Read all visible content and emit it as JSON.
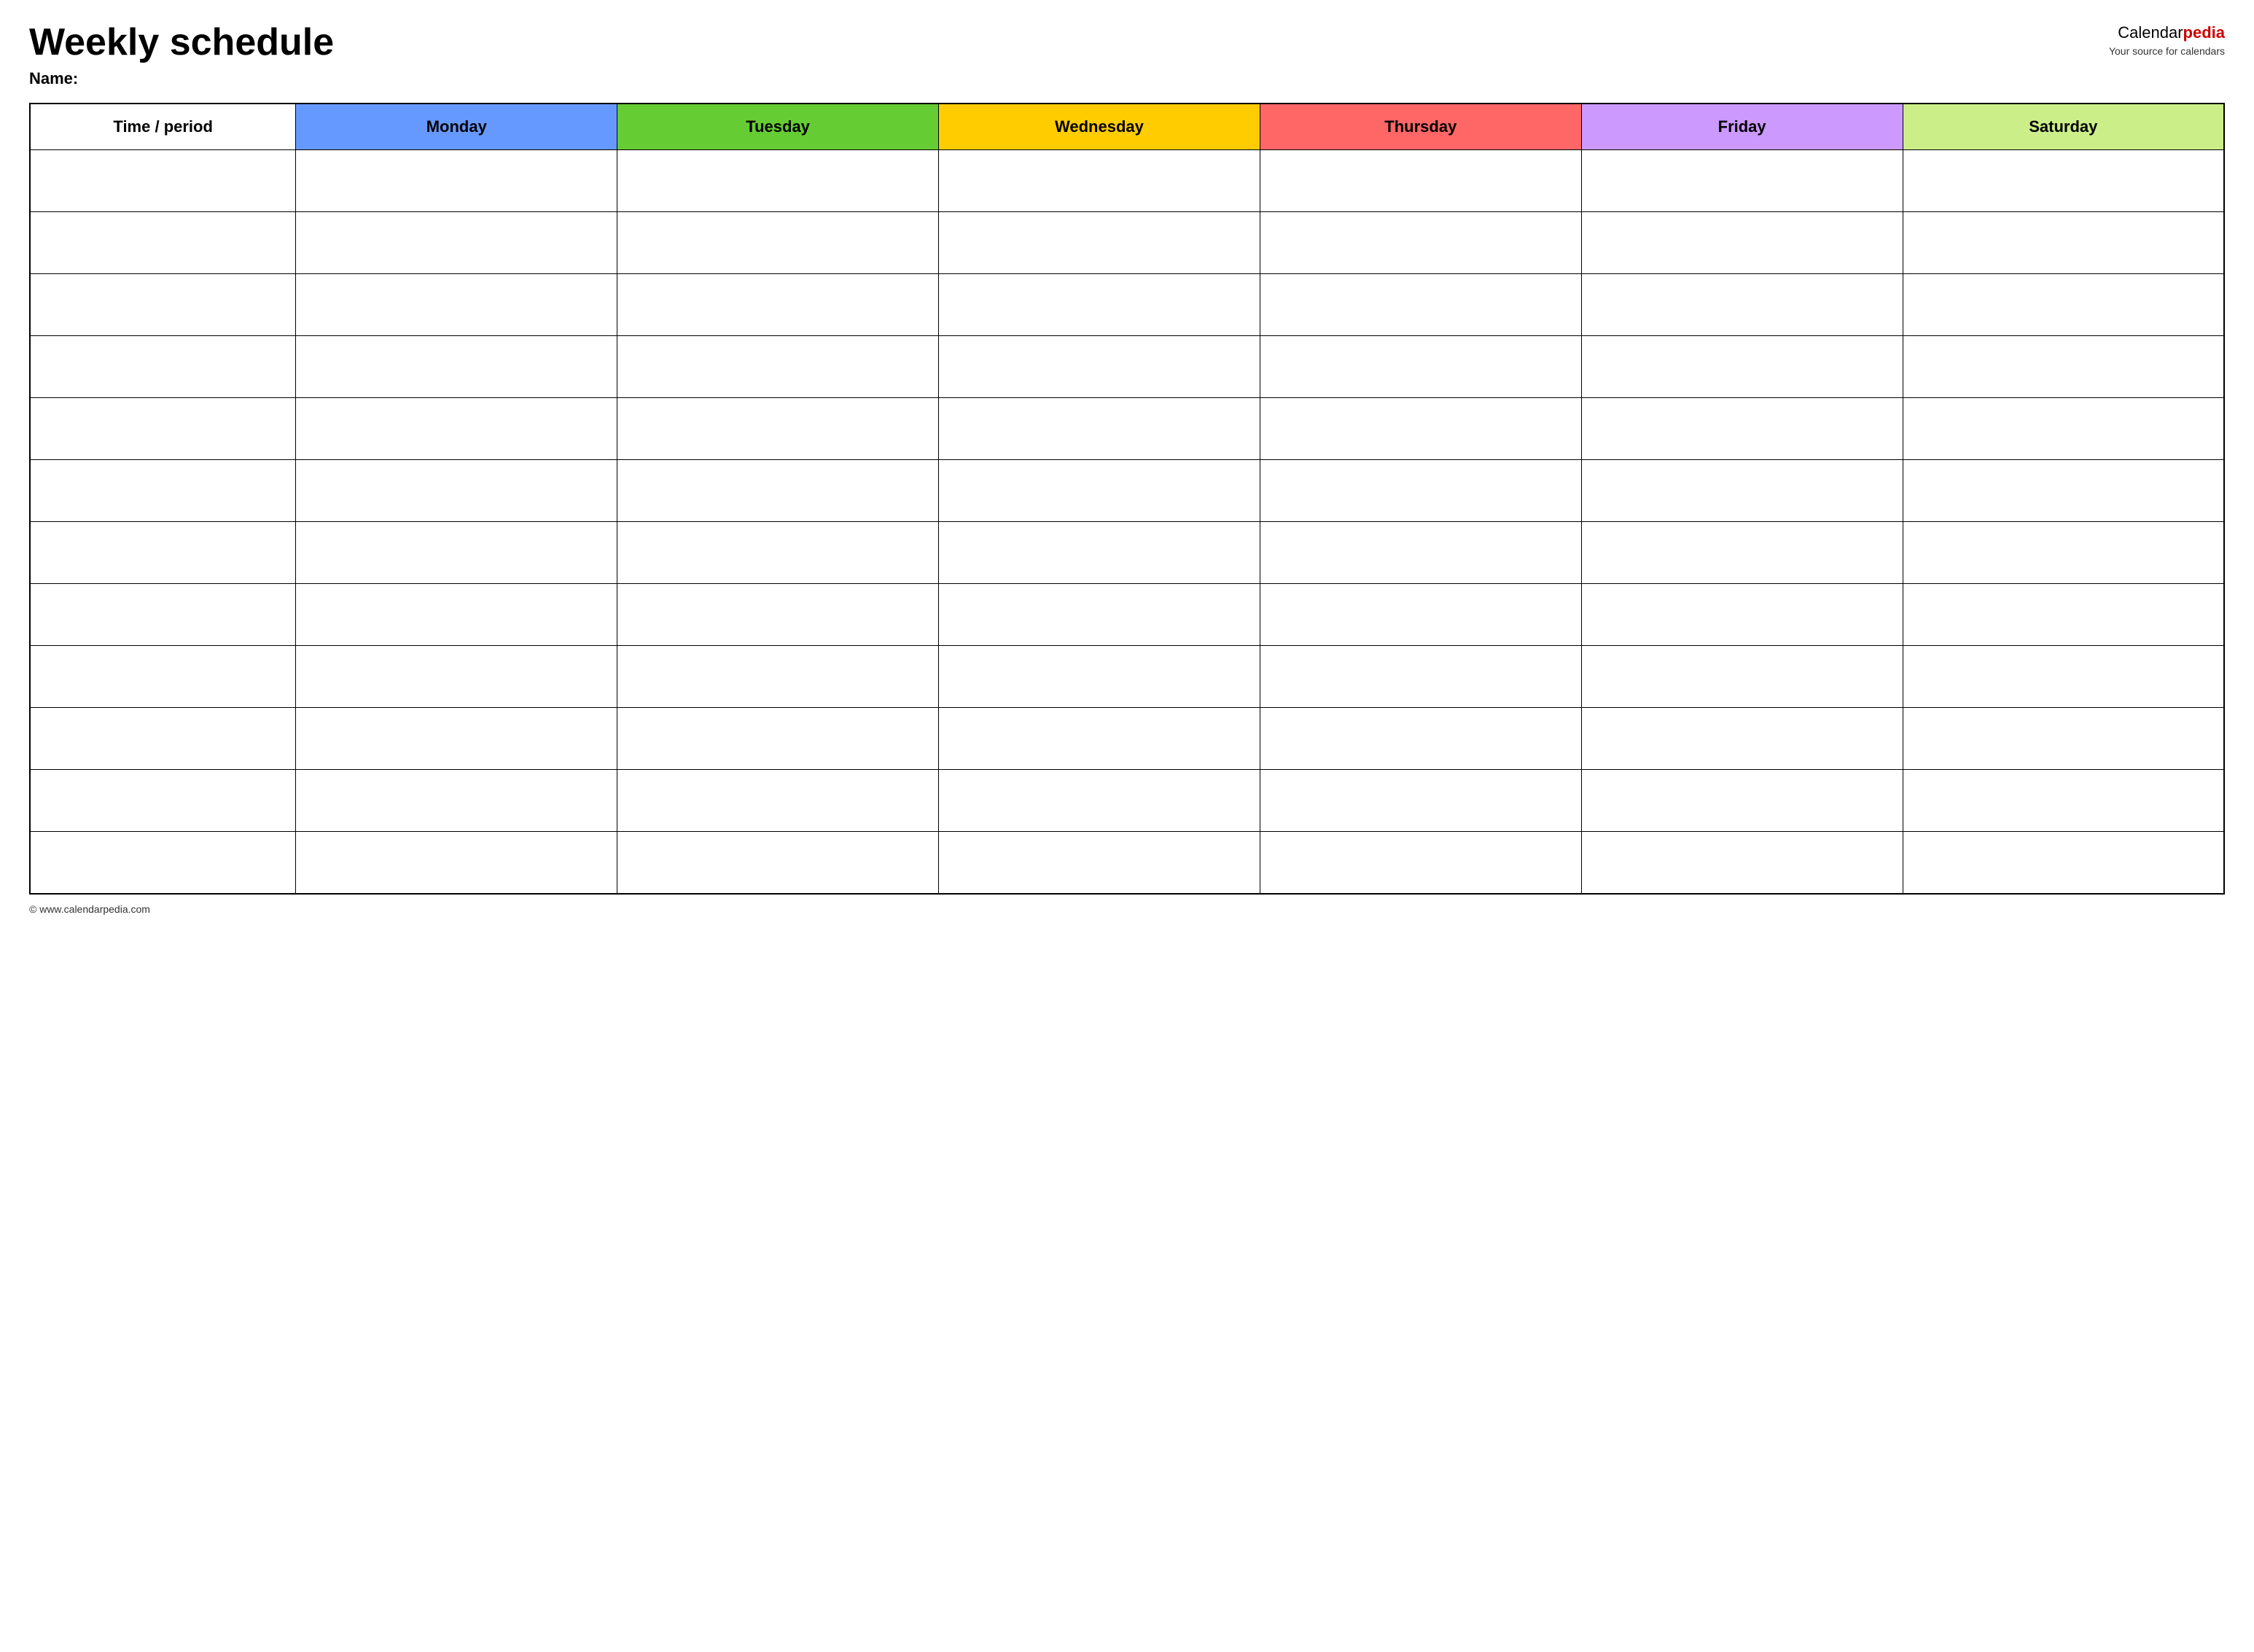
{
  "header": {
    "title": "Weekly schedule",
    "name_label": "Name:",
    "logo": {
      "calendar_text": "Calendar",
      "pedia_text": "pedia",
      "subtitle": "Your source for calendars"
    }
  },
  "table": {
    "columns": [
      {
        "label": "Time / period",
        "class": "th-time"
      },
      {
        "label": "Monday",
        "class": "th-monday"
      },
      {
        "label": "Tuesday",
        "class": "th-tuesday"
      },
      {
        "label": "Wednesday",
        "class": "th-wednesday"
      },
      {
        "label": "Thursday",
        "class": "th-thursday"
      },
      {
        "label": "Friday",
        "class": "th-friday"
      },
      {
        "label": "Saturday",
        "class": "th-saturday"
      }
    ],
    "rows": 12
  },
  "footer": {
    "url": "© www.calendarpedia.com"
  }
}
